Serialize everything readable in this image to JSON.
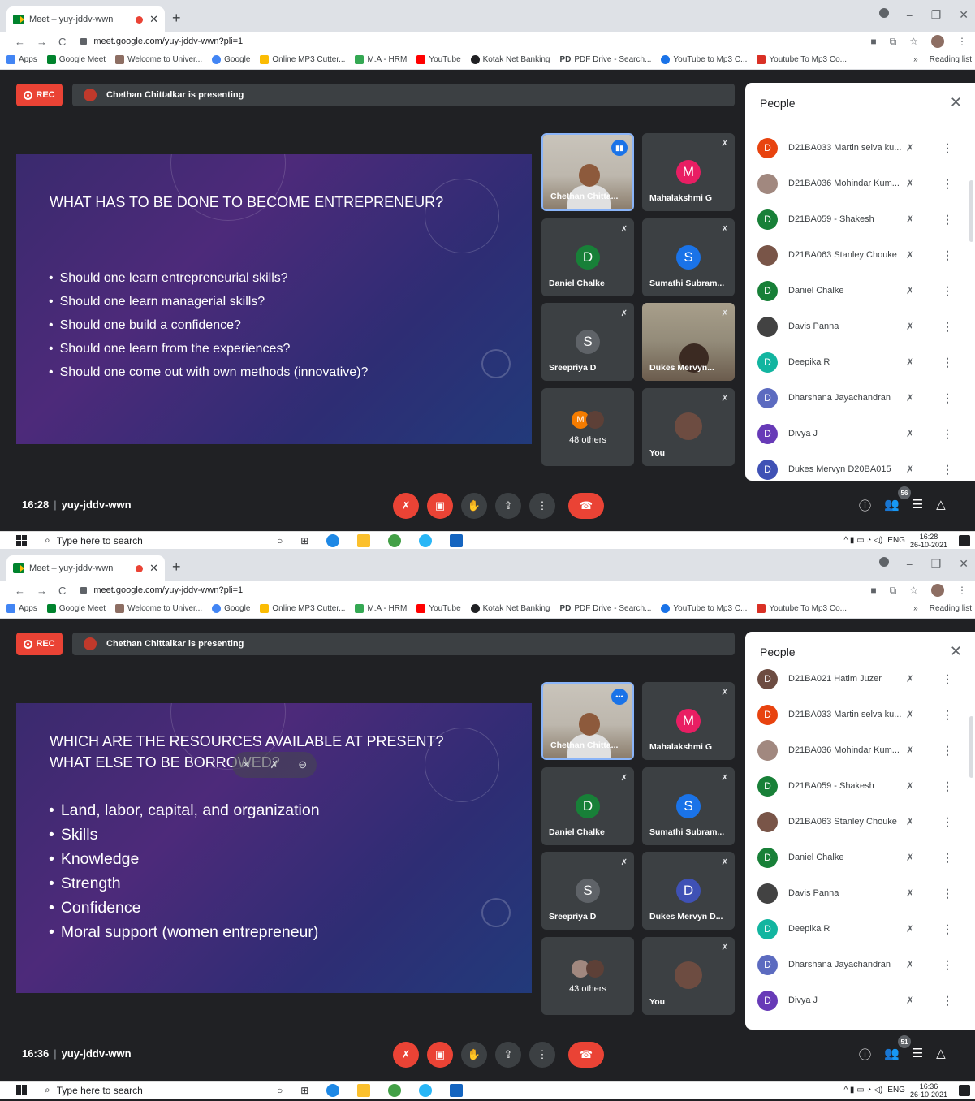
{
  "frames": [
    {
      "tab_title": "Meet – yuy-jddv-wwn",
      "url": "meet.google.com/yuy-jddv-wwn?pli=1",
      "bookmarks": [
        "Apps",
        "Google Meet",
        "Welcome to Univer...",
        "Google",
        "Online MP3 Cutter...",
        "M.A - HRM",
        "YouTube",
        "Kotak Net Banking",
        "PDF Drive - Search...",
        "YouTube to Mp3 C...",
        "Youtube To Mp3 Co..."
      ],
      "bookmarks_more": "»",
      "reading_list": "Reading list",
      "rec_label": "REC",
      "presenting": "Chethan Chittalkar is presenting",
      "slide_title": "WHAT HAS TO BE DONE TO BECOME ENTREPRENEUR?",
      "slide_bullets": [
        "Should one learn entrepreneurial skills?",
        "Should one learn managerial skills?",
        "Should one build a confidence?",
        "Should one learn from the experiences?",
        "Should one come out with own methods (innovative)?"
      ],
      "tiles": {
        "presenter": "Chethan Chitta...",
        "t2": {
          "name": "Mahalakshmi G",
          "initial": "M"
        },
        "t3": {
          "name": "Daniel Chalke",
          "initial": "D"
        },
        "t4": {
          "name": "Sumathi Subram...",
          "initial": "S"
        },
        "t5": {
          "name": "Sreepriya D",
          "initial": "S"
        },
        "t6": {
          "name": "Dukes Mervyn..."
        },
        "others_initial": "M",
        "others": "48 others",
        "you": "You"
      },
      "people_title": "People",
      "people": [
        {
          "initial": "D",
          "name": "D21BA033 Martin selva ku...",
          "color": "#e8430f"
        },
        {
          "initial": "",
          "name": "D21BA036 Mohindar Kum...",
          "color": "#a1887f"
        },
        {
          "initial": "D",
          "name": "D21BA059 - Shakesh",
          "color": "#188038"
        },
        {
          "initial": "",
          "name": "D21BA063 Stanley Chouke",
          "color": "#795548"
        },
        {
          "initial": "D",
          "name": "Daniel Chalke",
          "color": "#188038"
        },
        {
          "initial": "",
          "name": "Davis Panna",
          "color": "#424242"
        },
        {
          "initial": "D",
          "name": "Deepika R",
          "color": "#12b5a0"
        },
        {
          "initial": "D",
          "name": "Dharshana Jayachandran",
          "color": "#5c6bc0"
        },
        {
          "initial": "D",
          "name": "Divya J",
          "color": "#673ab7"
        },
        {
          "initial": "D",
          "name": "Dukes Mervyn D20BA015",
          "color": "#3f51b5"
        }
      ],
      "time": "16:28",
      "meeting_code": "yuy-jddv-wwn",
      "participant_count": "56",
      "taskbar": {
        "search": "Type here to search",
        "lang": "ENG",
        "clock_time": "16:28",
        "clock_date": "26-10-2021"
      }
    },
    {
      "tab_title": "Meet – yuy-jddv-wwn",
      "url": "meet.google.com/yuy-jddv-wwn?pli=1",
      "bookmarks": [
        "Apps",
        "Google Meet",
        "Welcome to Univer...",
        "Google",
        "Online MP3 Cutter...",
        "M.A - HRM",
        "YouTube",
        "Kotak Net Banking",
        "PDF Drive - Search...",
        "YouTube to Mp3 C...",
        "Youtube To Mp3 Co..."
      ],
      "bookmarks_more": "»",
      "reading_list": "Reading list",
      "rec_label": "REC",
      "presenting": "Chethan Chittalkar is presenting",
      "slide_title": "WHICH ARE THE RESOURCES AVAILABLE AT PRESENT?\nWHAT ELSE TO BE BORROWED?",
      "slide_bullets": [
        "Land, labor, capital, and organization",
        "Skills",
        "Knowledge",
        "Strength",
        "Confidence",
        "Moral support (women entrepreneur)"
      ],
      "tiles": {
        "presenter": "Chethan Chitta...",
        "t2": {
          "name": "Mahalakshmi G",
          "initial": "M"
        },
        "t3": {
          "name": "Daniel Chalke",
          "initial": "D"
        },
        "t4": {
          "name": "Sumathi Subram...",
          "initial": "S"
        },
        "t5": {
          "name": "Sreepriya D",
          "initial": "S"
        },
        "t6": {
          "name": "Dukes Mervyn D...",
          "initial": "D"
        },
        "others": "43 others",
        "you": "You"
      },
      "people_title": "People",
      "people": [
        {
          "initial": "D",
          "name": "D21BA021 Hatim Juzer",
          "color": "#6d4c41"
        },
        {
          "initial": "D",
          "name": "D21BA033 Martin selva ku...",
          "color": "#e8430f"
        },
        {
          "initial": "",
          "name": "D21BA036 Mohindar Kum...",
          "color": "#a1887f"
        },
        {
          "initial": "D",
          "name": "D21BA059 - Shakesh",
          "color": "#188038"
        },
        {
          "initial": "",
          "name": "D21BA063 Stanley Chouke",
          "color": "#795548"
        },
        {
          "initial": "D",
          "name": "Daniel Chalke",
          "color": "#188038"
        },
        {
          "initial": "",
          "name": "Davis Panna",
          "color": "#424242"
        },
        {
          "initial": "D",
          "name": "Deepika R",
          "color": "#12b5a0"
        },
        {
          "initial": "D",
          "name": "Dharshana Jayachandran",
          "color": "#5c6bc0"
        },
        {
          "initial": "D",
          "name": "Divya J",
          "color": "#673ab7"
        }
      ],
      "time": "16:36",
      "meeting_code": "yuy-jddv-wwn",
      "participant_count": "51",
      "taskbar": {
        "search": "Type here to search",
        "lang": "ENG",
        "clock_time": "16:36",
        "clock_date": "26-10-2021"
      }
    }
  ],
  "icons": {
    "mic_off": "🎙",
    "more": "⋮",
    "close": "✕",
    "hand": "✋",
    "present": "⬆",
    "end_call": "☎",
    "info": "ⓘ",
    "chat": "💬",
    "activities": "△"
  }
}
